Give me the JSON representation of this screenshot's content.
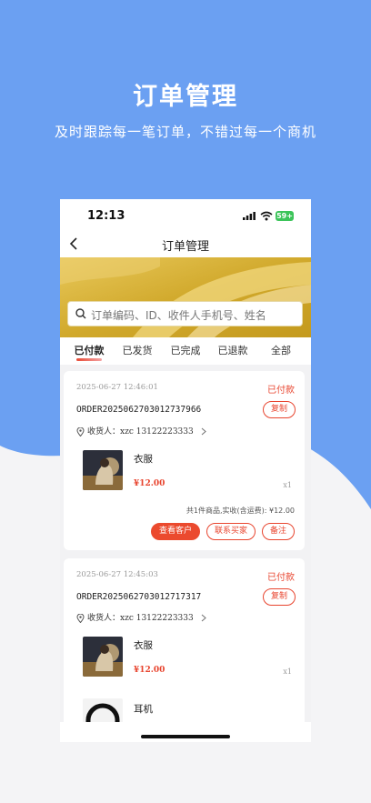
{
  "promo": {
    "title": "订单管理",
    "subtitle": "及时跟踪每一笔订单，不错过每一个商机"
  },
  "status_bar": {
    "time": "12:13",
    "battery": "59+"
  },
  "nav": {
    "title": "订单管理"
  },
  "search": {
    "placeholder": "订单编码、ID、收件人手机号、姓名"
  },
  "tabs": [
    {
      "label": "已付款",
      "active": true
    },
    {
      "label": "已发货",
      "active": false
    },
    {
      "label": "已完成",
      "active": false
    },
    {
      "label": "已退款",
      "active": false
    },
    {
      "label": "全部",
      "active": false
    }
  ],
  "orders": [
    {
      "date": "2025-06-27 12:46:01",
      "status": "已付款",
      "order_no": "ORDER2025062703012737966",
      "copy_label": "复制",
      "receiver_label": "收货人：",
      "receiver": "xzc 13122223333",
      "items": [
        {
          "name": "衣服",
          "price": "¥12.00",
          "qty": "x1"
        }
      ],
      "summary": "共1件商品,实收(含运费): ¥12.00",
      "buttons": {
        "view_customer": "查看客户",
        "contact_buyer": "联系买家",
        "note": "备注"
      }
    },
    {
      "date": "2025-06-27 12:45:03",
      "status": "已付款",
      "order_no": "ORDER2025062703012717317",
      "copy_label": "复制",
      "receiver_label": "收货人：",
      "receiver": "xzc 13122223333",
      "items": [
        {
          "name": "衣服",
          "price": "¥12.00",
          "qty": "x1"
        },
        {
          "name": "耳机"
        }
      ]
    }
  ],
  "colors": {
    "accent_red": "#e8452f",
    "promo_blue": "#6b9ff0",
    "banner_gold": "#d9b53a"
  }
}
